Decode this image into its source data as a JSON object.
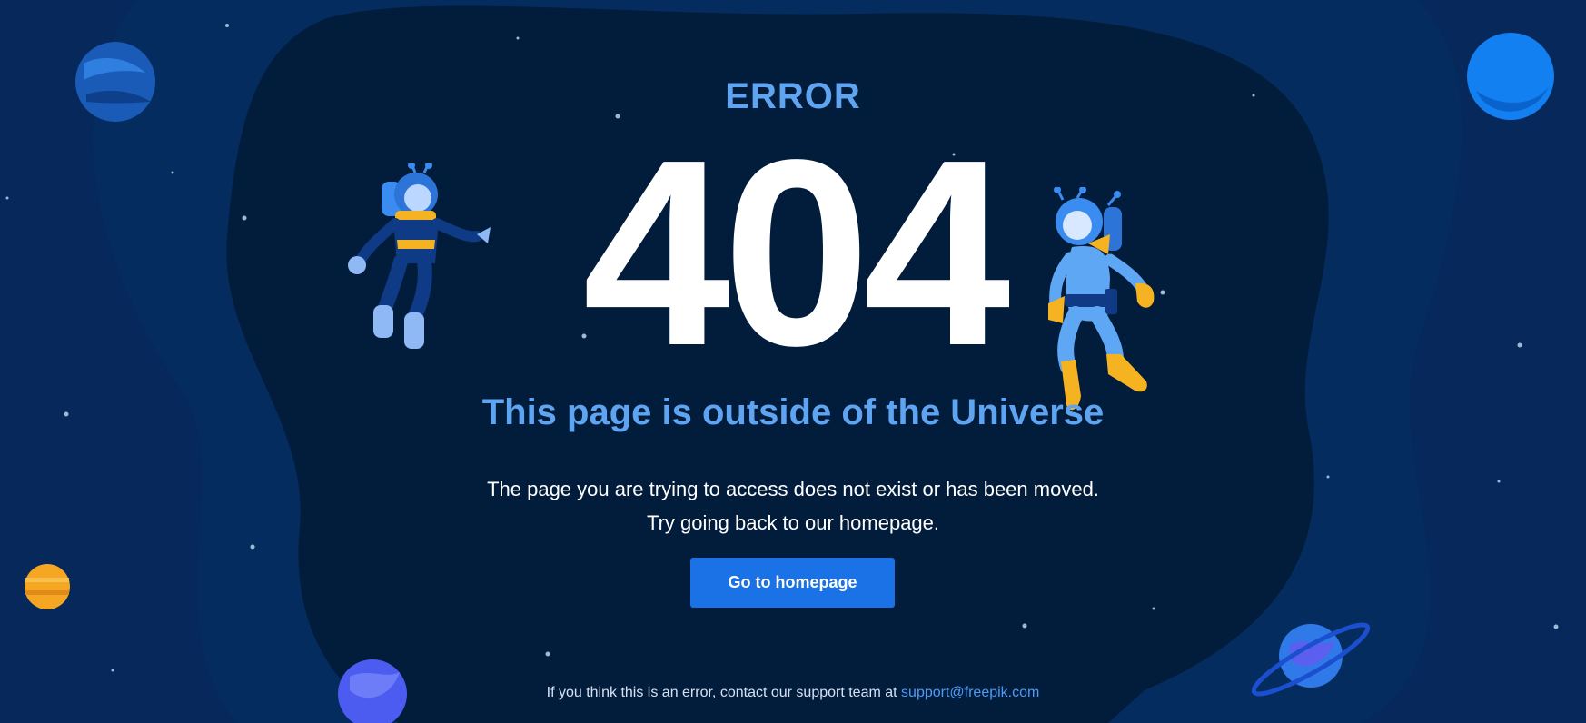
{
  "error_label": "ERROR",
  "error_code": "404",
  "headline": "This page is outside of the Universe",
  "description": {
    "line1": "The page you are trying to access does not exist or has been moved.",
    "line2": "Try going back to our homepage."
  },
  "cta": {
    "label": "Go to homepage"
  },
  "footer": {
    "text": "If you think this is an error, contact our support team at",
    "email": "support@freepik.com"
  },
  "colors": {
    "background": "#052955",
    "blob": "#021c3b",
    "accent_text": "#5fa4f0",
    "button": "#1a72e6",
    "link": "#4e9cf5"
  },
  "illustrations": [
    "planet-icon",
    "astronaut-icon",
    "star-icon"
  ]
}
